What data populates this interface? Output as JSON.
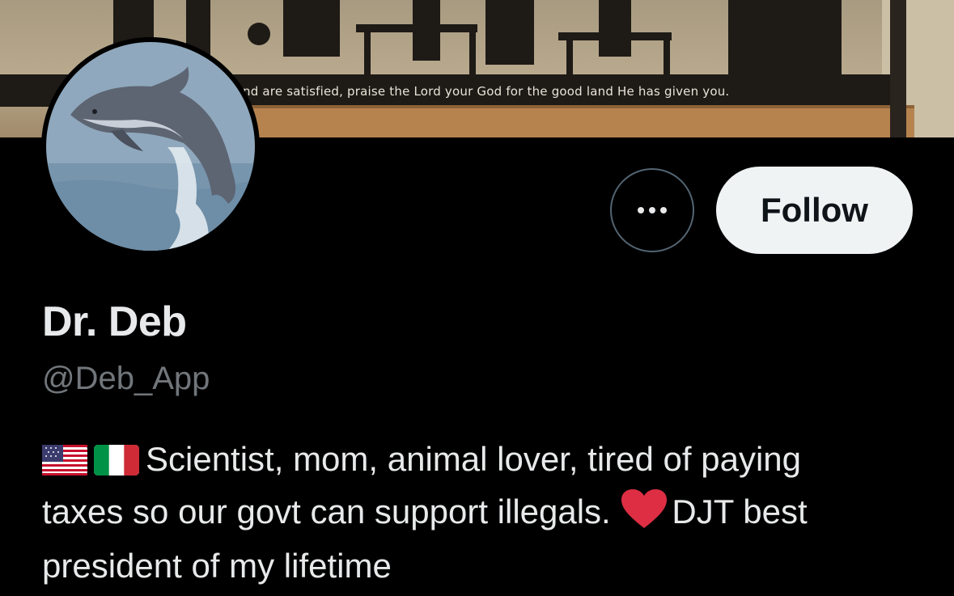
{
  "banner": {
    "text": "nd are satisfied, praise the Lord your God for the good land He has given you."
  },
  "profile": {
    "display_name": "Dr. Deb",
    "handle": "@Deb_App",
    "bio_line1": "Scientist, mom, animal lover, tired of paying",
    "bio_line2a": "taxes so our govt can support illegals.",
    "bio_line2b": "DJT best",
    "bio_line3": "president of my lifetime",
    "bio_emoji": [
      "us-flag-icon",
      "italy-flag-icon",
      "red-heart-icon"
    ]
  },
  "actions": {
    "more_icon": "ellipsis-icon",
    "follow_label": "Follow"
  },
  "colors": {
    "background": "#000000",
    "text_primary": "#e7e9ea",
    "text_secondary": "#71767b",
    "follow_bg": "#eff3f4",
    "heart": "#e0245e"
  }
}
